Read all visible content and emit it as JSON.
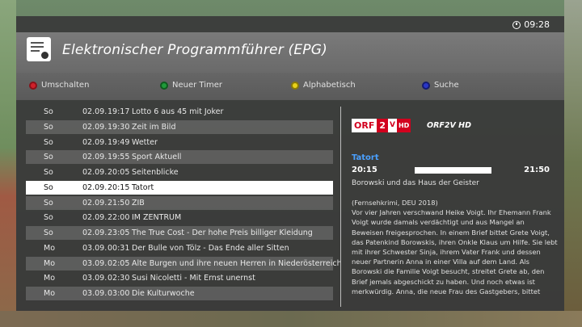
{
  "clock": {
    "time": "09:28",
    "icon": "clock-icon"
  },
  "header": {
    "title": "Elektronischer Programmführer (EPG)",
    "icon": "epg-icon"
  },
  "keys": [
    {
      "label": "Umschalten",
      "color": "#d0202a"
    },
    {
      "label": "Neuer Timer",
      "color": "#1f9a3a"
    },
    {
      "label": "Alphabetisch",
      "color": "#e8d21a"
    },
    {
      "label": "Suche",
      "color": "#2a36c8"
    }
  ],
  "programs": [
    {
      "day": "So",
      "date": "02.09.",
      "time": "19:17",
      "title": "Lotto 6 aus 45 mit Joker",
      "state": "normal"
    },
    {
      "day": "So",
      "date": "02.09.",
      "time": "19:30",
      "title": "Zeit im Bild",
      "state": "alt"
    },
    {
      "day": "So",
      "date": "02.09.",
      "time": "19:49",
      "title": "Wetter",
      "state": "normal"
    },
    {
      "day": "So",
      "date": "02.09.",
      "time": "19:55",
      "title": "Sport Aktuell",
      "state": "alt"
    },
    {
      "day": "So",
      "date": "02.09.",
      "time": "20:05",
      "title": "Seitenblicke",
      "state": "normal"
    },
    {
      "day": "So",
      "date": "02.09.",
      "time": "20:15",
      "title": "Tatort",
      "state": "selected"
    },
    {
      "day": "So",
      "date": "02.09.",
      "time": "21:50",
      "title": "ZIB",
      "state": "alt"
    },
    {
      "day": "So",
      "date": "02.09.",
      "time": "22:00",
      "title": "IM ZENTRUM",
      "state": "normal"
    },
    {
      "day": "So",
      "date": "02.09.",
      "time": "23:05",
      "title": "The True Cost - Der hohe Preis billiger Kleidung",
      "state": "alt"
    },
    {
      "day": "Mo",
      "date": "03.09.",
      "time": "00:31",
      "title": "Der Bulle von Tölz - Das Ende aller Sitten",
      "state": "normal"
    },
    {
      "day": "Mo",
      "date": "03.09.",
      "time": "02:05",
      "title": "Alte Burgen und ihre neuen Herren in Niederösterreich",
      "state": "alt"
    },
    {
      "day": "Mo",
      "date": "03.09.",
      "time": "02:30",
      "title": "Susi Nicoletti - Mit Ernst unernst",
      "state": "normal"
    },
    {
      "day": "Mo",
      "date": "03.09.",
      "time": "03:00",
      "title": "Die Kulturwoche",
      "state": "alt"
    }
  ],
  "detail": {
    "logo": {
      "orf": "ORF",
      "num": "2",
      "v": "V",
      "hd": "HD"
    },
    "channel": "ORF2V HD",
    "title": "Tatort",
    "start": "20:15",
    "end": "21:50",
    "subtitle": "Borowski und das Haus der Geister",
    "description": "(Fernsehkrimi, DEU 2018)\nVor vier Jahren verschwand Heike Voigt. Ihr Ehemann Frank Voigt wurde damals verdächtigt und aus Mangel an Beweisen freigesprochen. In einem Brief bittet Grete Voigt, das Patenkind Borowskis, ihren Onkle Klaus um Hilfe. Sie lebt mit ihrer Schwester Sinja, ihrem Vater Frank und dessen neuer Partnerin Anna in einer Villa auf dem Land. Als Borowski die Familie Voigt besucht, streitet Grete ab, den Brief jemals abgeschickt zu haben. Und noch etwas ist merkwürdig. Anna, die neue Frau des Gastgebers, bittet"
  }
}
